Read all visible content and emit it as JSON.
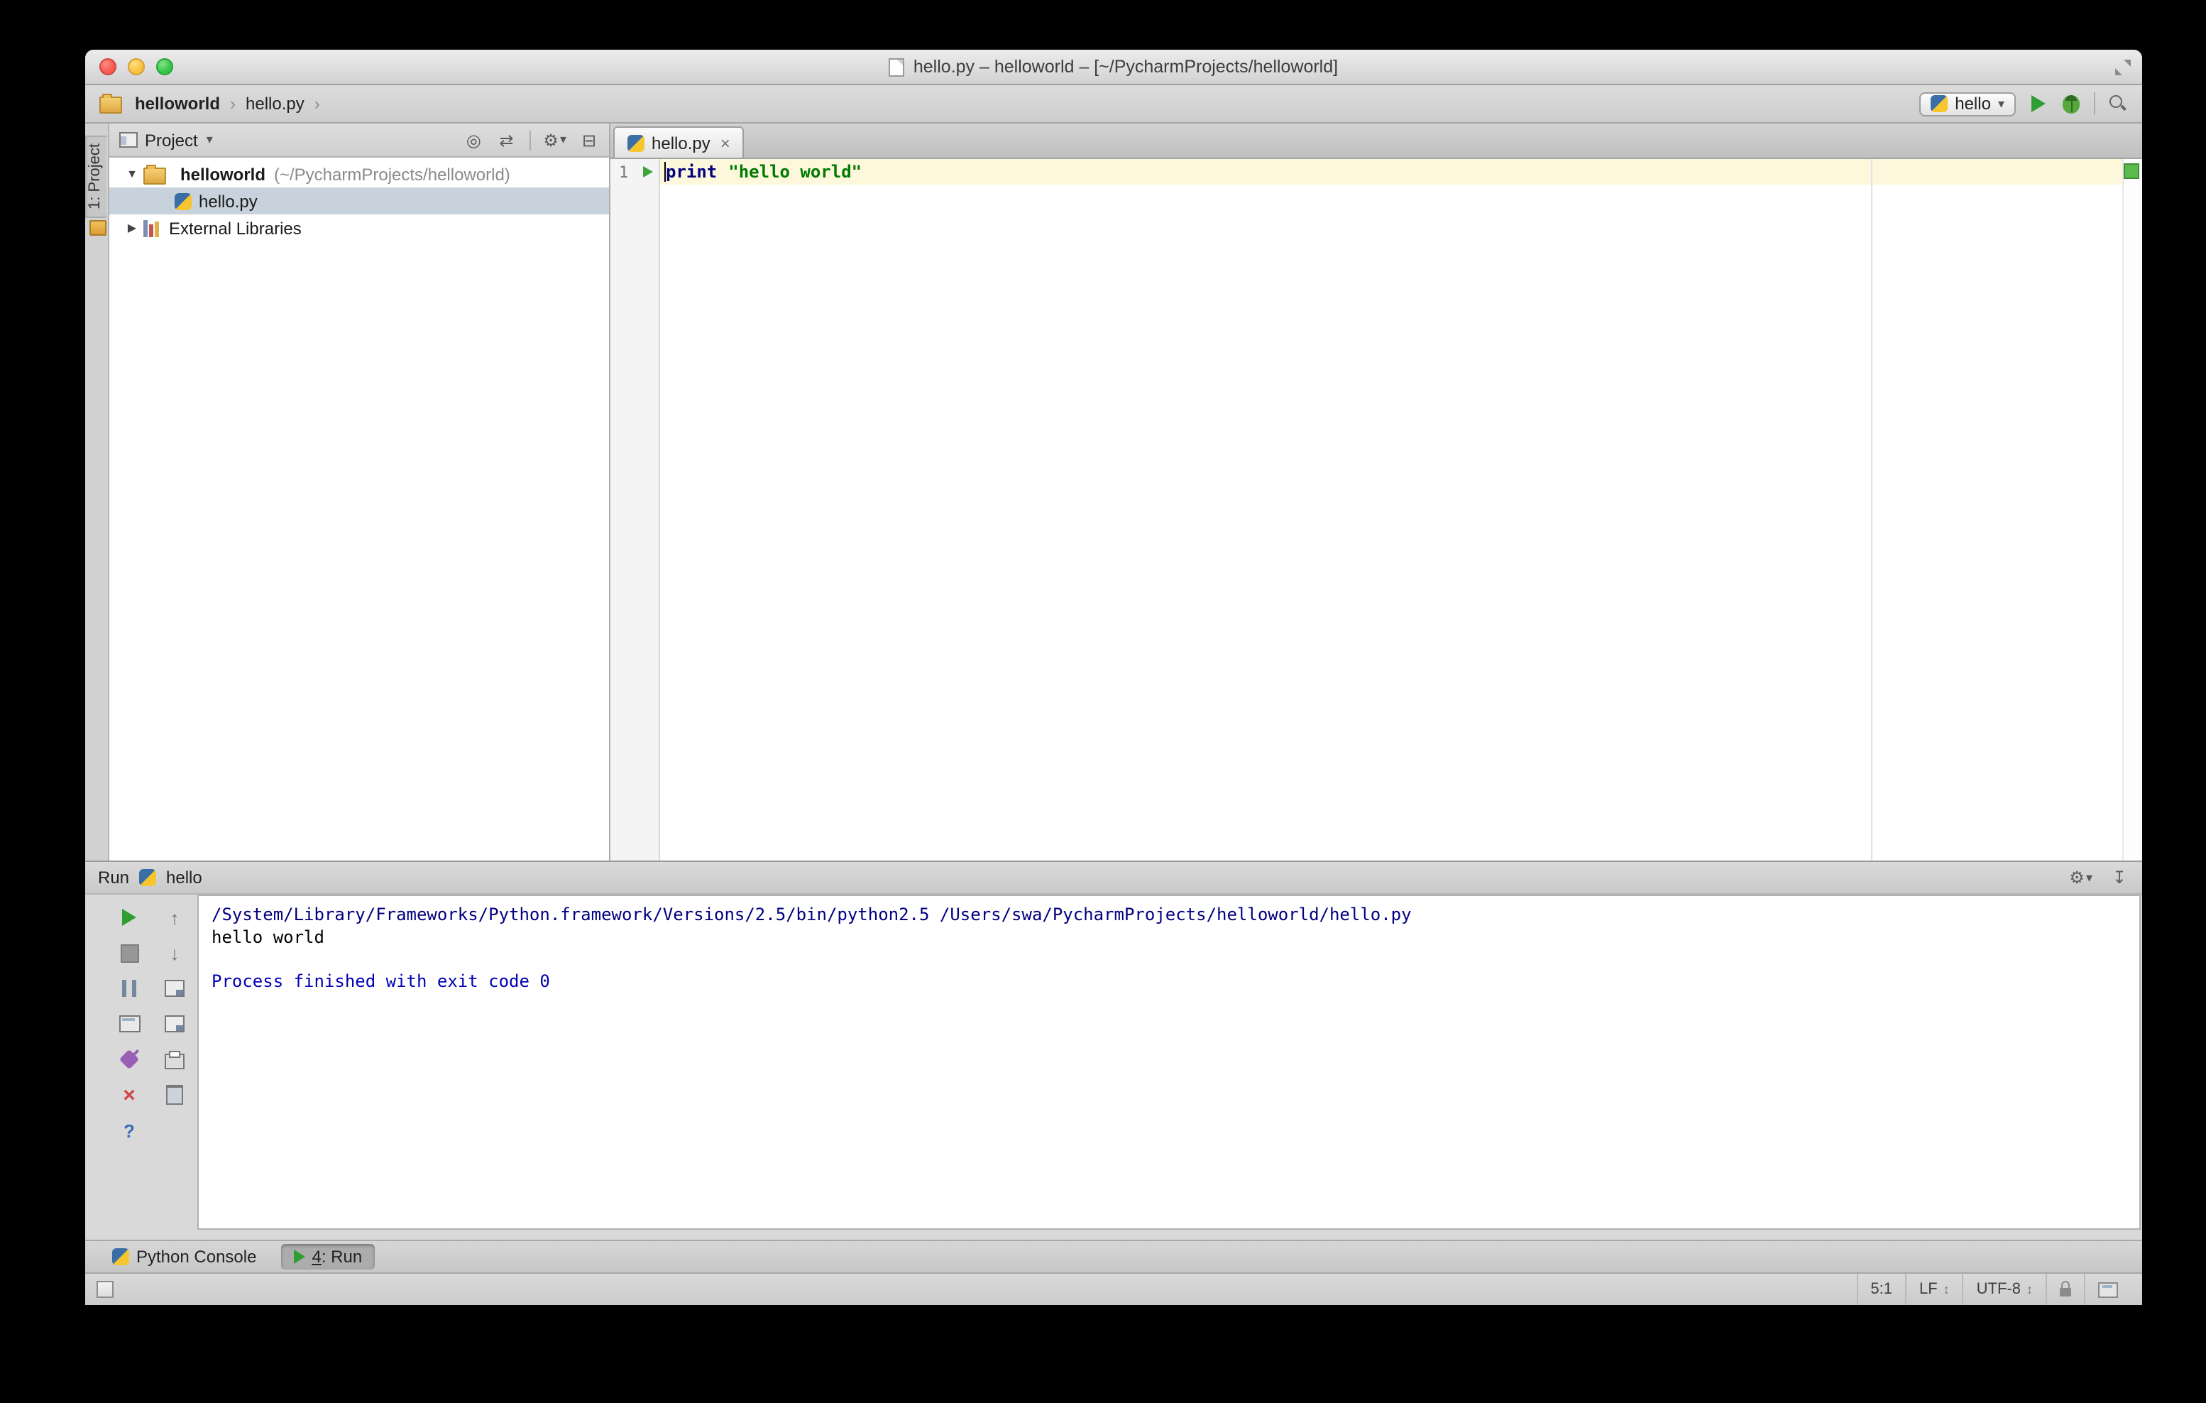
{
  "window": {
    "title": "hello.py – helloworld – [~/PycharmProjects/helloworld]"
  },
  "navbar": {
    "breadcrumbs": [
      "helloworld",
      "hello.py"
    ],
    "run_config": "hello"
  },
  "tool_stripe": {
    "project_tab": "1: Project"
  },
  "project_panel": {
    "header": "Project",
    "tree": {
      "root_label": "helloworld",
      "root_path": "(~/PycharmProjects/helloworld)",
      "file": "hello.py",
      "external": "External Libraries"
    }
  },
  "editor": {
    "tab": "hello.py",
    "line_number": "1",
    "code": {
      "keyword": "print",
      "string": "\"hello world\""
    }
  },
  "run_panel": {
    "title": "Run",
    "tab": "hello",
    "console": {
      "line1": "/System/Library/Frameworks/Python.framework/Versions/2.5/bin/python2.5 /Users/swa/PycharmProjects/helloworld/hello.py",
      "line2": "hello world",
      "line3": "",
      "line4": "Process finished with exit code 0"
    }
  },
  "bottom_bar": {
    "python_console": "Python Console",
    "run_num": "4",
    "run_label": ": Run"
  },
  "status_bar": {
    "caret": "5:1",
    "line_sep": "LF",
    "encoding": "UTF-8"
  },
  "colors": {
    "run_green": "#2f9e32",
    "ok_indicator": "#5dbb4d",
    "keyword_blue": "#000080",
    "string_green": "#007a00",
    "console_info_blue": "#0000b3",
    "selection_gray_blue": "#c7d2dc",
    "current_line_yellow": "#fdf8dc"
  }
}
